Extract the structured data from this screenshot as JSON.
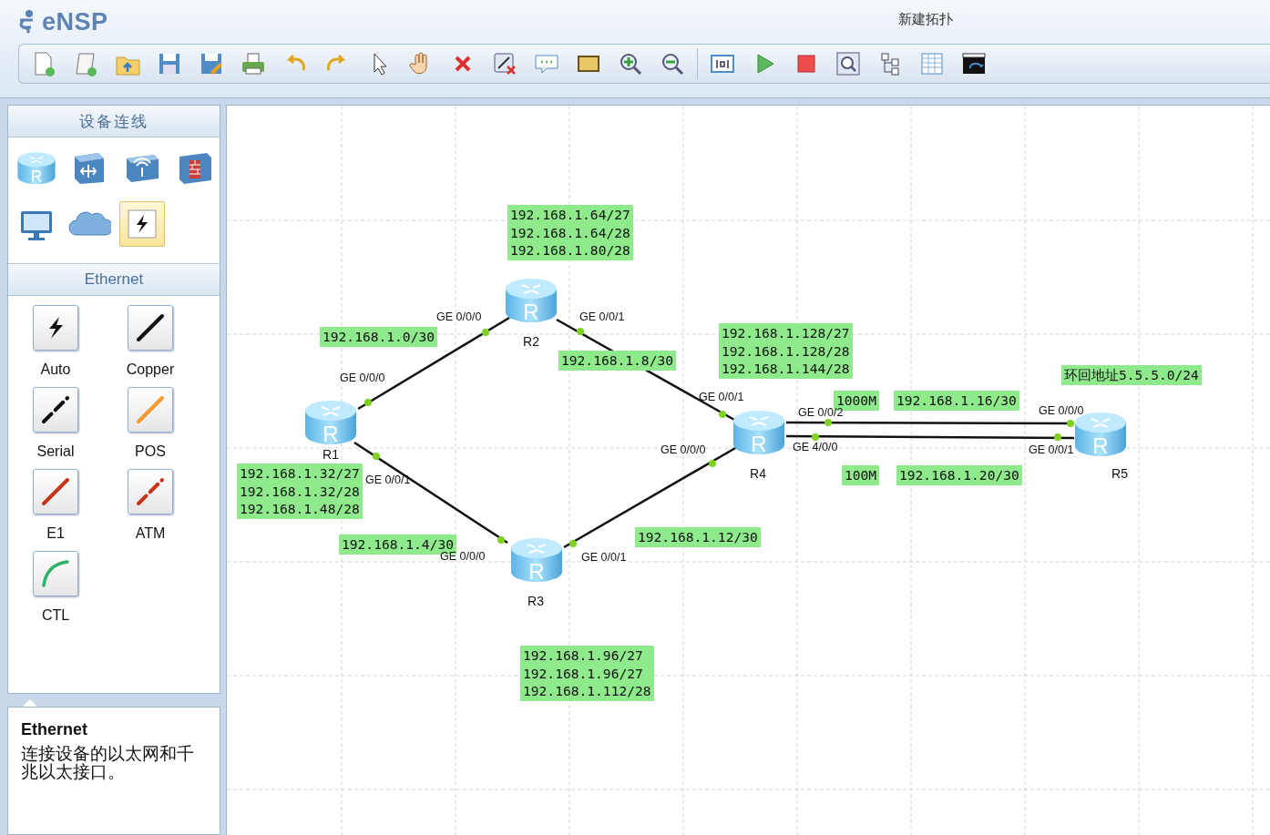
{
  "app": {
    "logo": "eNSP",
    "title": "新建拓扑"
  },
  "device_panel": {
    "title": "设备连线",
    "devices": [
      {
        "kind": "router",
        "glyph": "R",
        "selected": false
      },
      {
        "kind": "switch",
        "selected": false
      },
      {
        "kind": "wlan",
        "selected": false
      },
      {
        "kind": "firewall",
        "selected": false
      },
      {
        "kind": "pc",
        "selected": false
      },
      {
        "kind": "cloud",
        "selected": false
      },
      {
        "kind": "cable",
        "selected": true
      }
    ]
  },
  "link_panel": {
    "title": "Ethernet",
    "links": [
      {
        "kind": "auto",
        "label": "Auto"
      },
      {
        "kind": "copper",
        "label": "Copper"
      },
      {
        "kind": "serial",
        "label": "Serial"
      },
      {
        "kind": "pos",
        "label": "POS"
      },
      {
        "kind": "e1",
        "label": "E1"
      },
      {
        "kind": "atm",
        "label": "ATM"
      },
      {
        "kind": "ctl",
        "label": "CTL"
      }
    ]
  },
  "description": {
    "title": "Ethernet",
    "text": "连接设备的以太网和千兆以太接口。"
  },
  "topology": {
    "routers": [
      {
        "name": "R1",
        "glyph": "R"
      },
      {
        "name": "R2",
        "glyph": "R"
      },
      {
        "name": "R3",
        "glyph": "R"
      },
      {
        "name": "R4",
        "glyph": "R"
      },
      {
        "name": "R5",
        "glyph": "R"
      }
    ],
    "port_labels": [
      "GE 0/0/0",
      "GE 0/0/1",
      "GE 0/0/0",
      "GE 0/0/1",
      "GE 0/0/0",
      "GE 0/0/1",
      "GE 0/0/1",
      "GE 0/0/0",
      "GE 0/0/2",
      "GE 4/0/0",
      "GE 0/0/0",
      "GE 0/0/1"
    ],
    "notes": [
      {
        "lines": [
          "192.168.1.64/27",
          "192.168.1.64/28",
          "192.168.1.80/28"
        ]
      },
      {
        "lines": [
          "192.168.1.0/30"
        ]
      },
      {
        "lines": [
          "192.168.1.128/27",
          "192.168.1.128/28",
          "192.168.1.144/28"
        ]
      },
      {
        "lines": [
          "192.168.1.8/30"
        ]
      },
      {
        "lines": [
          "环回地址5.5.5.0/24"
        ]
      },
      {
        "lines": [
          "1000M"
        ]
      },
      {
        "lines": [
          "192.168.1.16/30"
        ]
      },
      {
        "lines": [
          "192.168.1.32/27",
          "192.168.1.32/28",
          "192.168.1.48/28"
        ]
      },
      {
        "lines": [
          "100M"
        ]
      },
      {
        "lines": [
          "192.168.1.20/30"
        ]
      },
      {
        "lines": [
          "192.168.1.4/30"
        ]
      },
      {
        "lines": [
          "192.168.1.12/30"
        ]
      },
      {
        "lines": [
          "192.168.1.96/27",
          "192.168.1.96/27",
          "192.168.1.112/28"
        ]
      }
    ]
  }
}
